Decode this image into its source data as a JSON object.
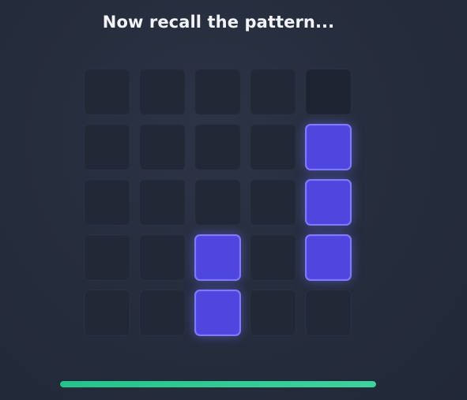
{
  "game": {
    "title": "Now recall the pattern...",
    "grid_rows": 5,
    "grid_cols": 5,
    "cells": [
      [
        0,
        0,
        0,
        0,
        0
      ],
      [
        0,
        0,
        0,
        0,
        1
      ],
      [
        0,
        0,
        0,
        0,
        1
      ],
      [
        0,
        0,
        1,
        0,
        1
      ],
      [
        0,
        0,
        1,
        0,
        0
      ]
    ],
    "progress": 1.0
  },
  "colors": {
    "active_tile": "#4f46e0",
    "progress_bar": "#2ec994"
  }
}
